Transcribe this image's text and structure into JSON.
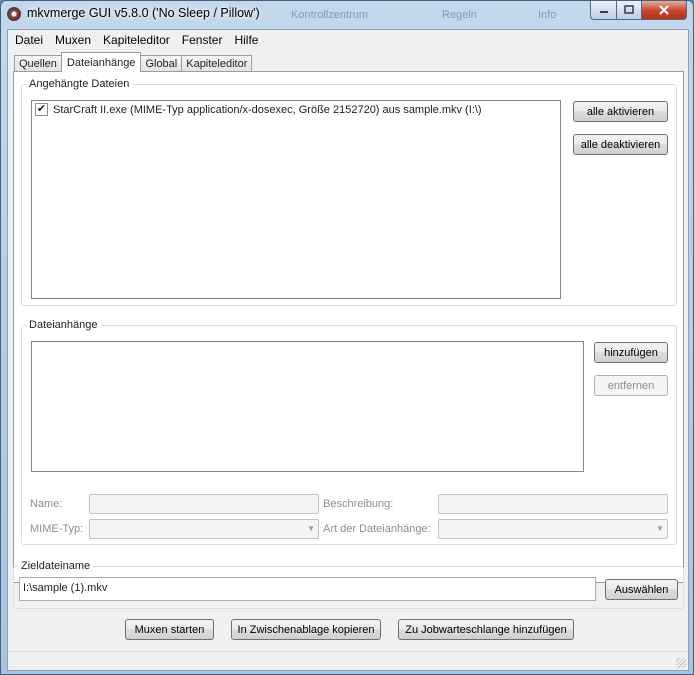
{
  "window": {
    "title": "mkvmerge GUI v5.8.0 ('No Sleep / Pillow')",
    "background_hints": [
      "Kontrollzentrum",
      "Regeln",
      "Info"
    ]
  },
  "menubar": [
    "Datei",
    "Muxen",
    "Kapiteleditor",
    "Fenster",
    "Hilfe"
  ],
  "tabs": [
    "Quellen",
    "Dateianhänge",
    "Global",
    "Kapiteleditor"
  ],
  "active_tab": "Dateianhänge",
  "attached_files": {
    "legend": "Angehängte Dateien",
    "items": [
      {
        "checked": true,
        "text": "StarCraft II.exe (MIME-Typ application/x-dosexec, Größe 2152720) aus sample.mkv (I:\\)"
      }
    ],
    "enable_all": "alle aktivieren",
    "disable_all": "alle deaktivieren"
  },
  "attachments": {
    "legend": "Dateianhänge",
    "add": "hinzufügen",
    "remove": "entfernen",
    "name_label": "Name:",
    "description_label": "Beschreibung:",
    "mime_label": "MIME-Typ:",
    "attachment_type_label": "Art der Dateianhänge:"
  },
  "output": {
    "legend": "Zieldateiname",
    "value": "I:\\sample (1).mkv",
    "browse": "Auswählen"
  },
  "actions": {
    "start": "Muxen starten",
    "copy": "In Zwischenablage kopieren",
    "queue": "Zu Jobwarteschlange hinzufügen"
  },
  "colors": {
    "titlebar": "#b3cbe3",
    "close_button": "#c7432d",
    "dialog_bg": "#f0f0f0"
  }
}
